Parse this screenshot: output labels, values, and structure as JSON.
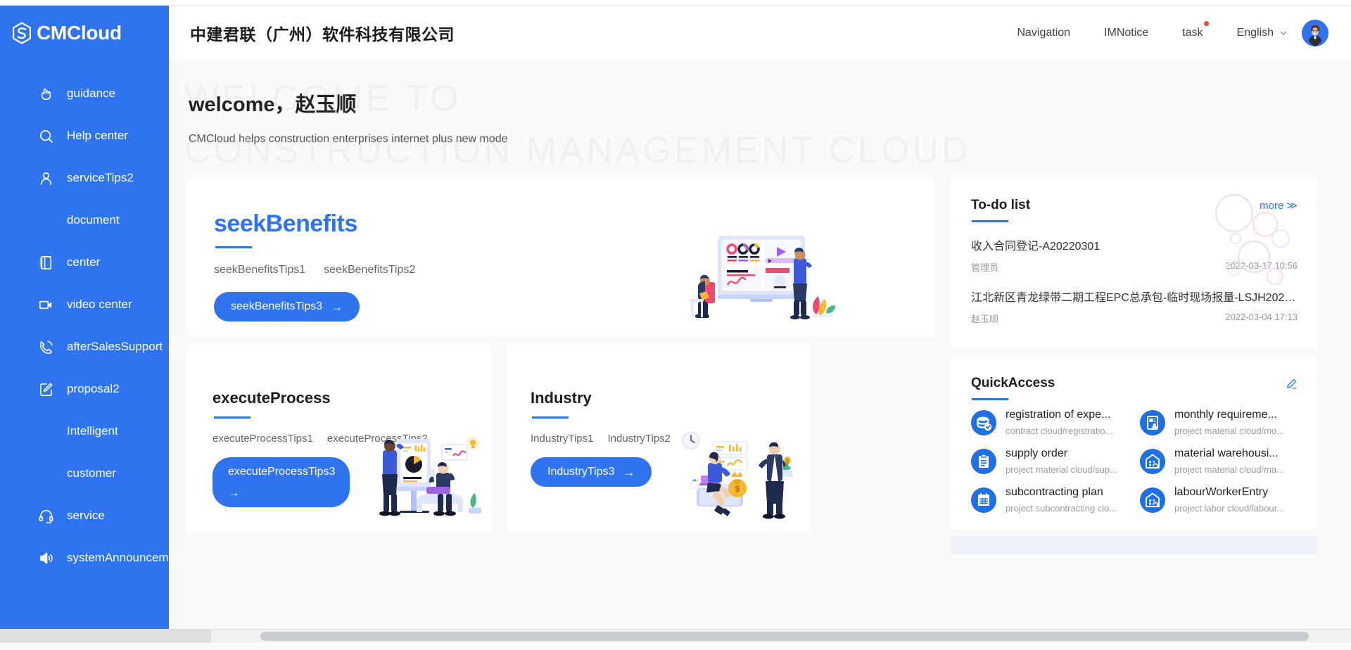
{
  "brand": {
    "name": "CMCloud",
    "color": "#2f74ee"
  },
  "sidebar": {
    "items": [
      {
        "label": "guidance",
        "icon": "hand-click-icon",
        "sub": false
      },
      {
        "label": "Help center",
        "icon": "search-icon",
        "sub": false
      },
      {
        "label": "serviceTips2",
        "icon": "user-icon",
        "sub": false
      },
      {
        "label": "document",
        "icon": "none",
        "sub": true
      },
      {
        "label": "center",
        "icon": "notebook-icon",
        "sub": false
      },
      {
        "label": "video center",
        "icon": "video-camera-icon",
        "sub": false
      },
      {
        "label": "afterSalesSupport",
        "icon": "phone-call-icon",
        "sub": false
      },
      {
        "label": "proposal2",
        "icon": "edit-square-icon",
        "sub": false
      },
      {
        "label": "Intelligent",
        "icon": "none",
        "sub": true
      },
      {
        "label": "customer",
        "icon": "none",
        "sub": true
      },
      {
        "label": "service",
        "icon": "headset-icon",
        "sub": false
      },
      {
        "label": "systemAnnouncement",
        "icon": "speaker-icon",
        "sub": false
      }
    ]
  },
  "header": {
    "company": "中建君联（广州）软件科技有限公司",
    "nav": "Navigation",
    "imnotice": "IMNotice",
    "task": "task",
    "language": "English",
    "avatar_name": "user-avatar"
  },
  "welcome": {
    "watermark_line1": "WELCOME TO",
    "watermark_line2": "CONSTRUCTION MANAGEMENT CLOUD",
    "title": "welcome，赵玉顺",
    "subtitle": "CMCloud helps construction enterprises internet plus new mode"
  },
  "hero": {
    "title": "seekBenefits",
    "tip1": "seekBenefitsTips1",
    "tip2": "seekBenefitsTips2",
    "cta": "seekBenefitsTips3",
    "arrow": "→"
  },
  "cards": [
    {
      "title": "executeProcess",
      "tip1": "executeProcessTips1",
      "tip2": "executeProcessTips2",
      "cta": "executeProcessTips3",
      "arrow": "→"
    },
    {
      "title": "Industry",
      "tip1": "IndustryTips1",
      "tip2": "IndustryTips2",
      "cta": "IndustryTips3",
      "arrow": "→"
    }
  ],
  "todo": {
    "title": "To-do list",
    "more": "more",
    "more_chevron": "≫",
    "items": [
      {
        "name": "收入合同登记-A20220301",
        "owner": "管理员",
        "time": "2022-03-17 10:56"
      },
      {
        "name": "江北新区青龙绿带二期工程EPC总承包-临时现场报量-LSJH20220...",
        "owner": "赵玉顺",
        "time": "2022-03-04 17:13"
      }
    ]
  },
  "quickaccess": {
    "title": "QuickAccess",
    "edit_icon": "pencil-edit-icon",
    "items": [
      {
        "label": "registration of expe...",
        "path": "contract cloud/registratio...",
        "icon": "database-check-icon"
      },
      {
        "label": "monthly requireme...",
        "path": "project material cloud/mo...",
        "icon": "document-person-icon"
      },
      {
        "label": "supply order",
        "path": "project material cloud/sup...",
        "icon": "clipboard-icon"
      },
      {
        "label": "material warehousi...",
        "path": "project material cloud/ma...",
        "icon": "warehouse-icon"
      },
      {
        "label": "subcontracting plan",
        "path": "project subcontracting clo...",
        "icon": "calendar-table-icon"
      },
      {
        "label": "labourWorkerEntry",
        "path": "project labor cloud/labour...",
        "icon": "warehouse-icon"
      }
    ]
  }
}
